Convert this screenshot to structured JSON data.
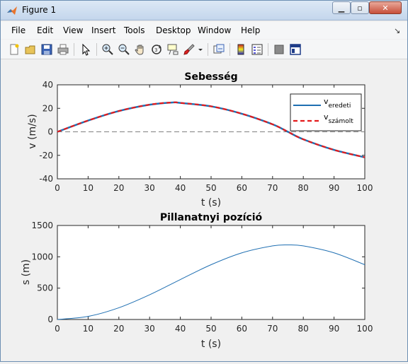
{
  "window": {
    "title": "Figure 1"
  },
  "menu": {
    "items": [
      "File",
      "Edit",
      "View",
      "Insert",
      "Tools",
      "Desktop",
      "Window",
      "Help"
    ]
  },
  "toolbar": {
    "icons": [
      "new-figure-icon",
      "open-file-icon",
      "save-icon",
      "print-icon",
      "edit-plot-arrow-icon",
      "zoom-in-icon",
      "zoom-out-icon",
      "pan-hand-icon",
      "rotate-3d-icon",
      "data-cursor-icon",
      "brush-icon",
      "brush-dropdown-icon",
      "link-plot-icon",
      "insert-colorbar-icon",
      "insert-legend-icon",
      "hide-plot-tools-icon",
      "show-plot-tools-icon"
    ]
  },
  "colors": {
    "series_original": "#1f6fb2",
    "series_computed": "#e41a1c",
    "zero_line": "#808080"
  },
  "chart_data": [
    {
      "type": "line",
      "title": "Sebesség",
      "xlabel": "t (s)",
      "ylabel": "v (m/s)",
      "xlim": [
        0,
        100
      ],
      "ylim": [
        -40,
        40
      ],
      "xticks": [
        0,
        10,
        20,
        30,
        40,
        50,
        60,
        70,
        80,
        90,
        100
      ],
      "yticks": [
        -40,
        -20,
        0,
        20,
        40
      ],
      "grid": false,
      "legend_position": "top-right",
      "reference_line": {
        "y": 0,
        "style": "dashed"
      },
      "series": [
        {
          "name": "v_eredeti",
          "label_main": "v",
          "label_sub": "eredeti",
          "style": "solid",
          "x": [
            0,
            10,
            20,
            30,
            37.5,
            40,
            50,
            60,
            70,
            75,
            80,
            90,
            100
          ],
          "y": [
            0,
            9.6,
            17.7,
            23.1,
            25.0,
            24.6,
            21.7,
            15.4,
            6.4,
            0,
            -6.4,
            -15.4,
            -21.7
          ]
        },
        {
          "name": "v_számolt",
          "label_main": "v",
          "label_sub": "számolt",
          "style": "dashed",
          "x": [
            0,
            10,
            20,
            30,
            37.5,
            40,
            50,
            60,
            70,
            75,
            80,
            90,
            100
          ],
          "y": [
            0,
            9.6,
            17.7,
            23.1,
            25.0,
            24.6,
            21.7,
            15.4,
            6.4,
            0,
            -6.4,
            -15.4,
            -21.7
          ]
        }
      ]
    },
    {
      "type": "line",
      "title": "Pillanatnyi pozíció",
      "xlabel": "t (s)",
      "ylabel": "s (m)",
      "xlim": [
        0,
        100
      ],
      "ylim": [
        0,
        1500
      ],
      "xticks": [
        0,
        10,
        20,
        30,
        40,
        50,
        60,
        70,
        80,
        90,
        100
      ],
      "yticks": [
        0,
        500,
        1000,
        1500
      ],
      "grid": false,
      "series": [
        {
          "style": "solid",
          "x": [
            0,
            10,
            20,
            30,
            40,
            50,
            60,
            70,
            75,
            80,
            90,
            100
          ],
          "y": [
            0,
            49,
            187,
            394,
            637,
            874,
            1063,
            1174,
            1190,
            1174,
            1063,
            874
          ]
        }
      ]
    }
  ]
}
